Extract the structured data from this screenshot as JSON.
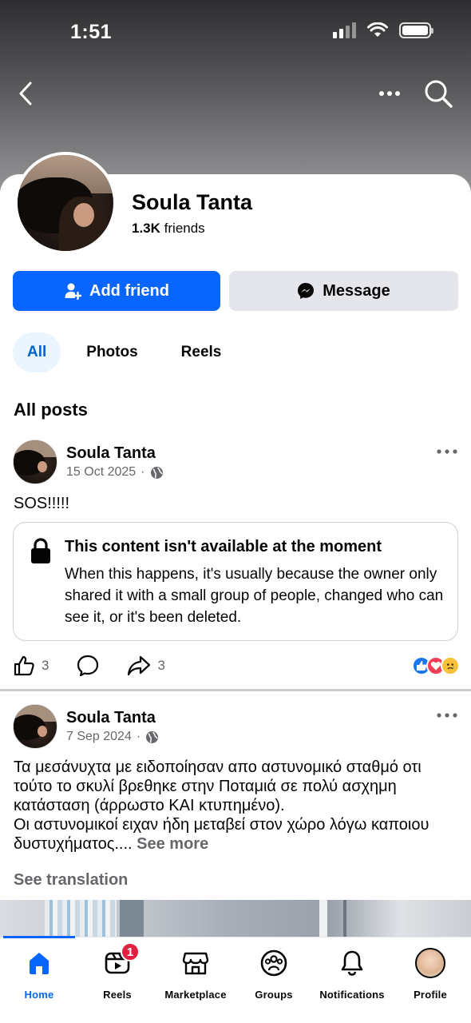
{
  "status_bar": {
    "time": "1:51"
  },
  "profile": {
    "name": "Soula Tanta",
    "friends_count": "1.3K",
    "friends_label": "friends",
    "add_friend_label": "Add friend",
    "message_label": "Message"
  },
  "filters": [
    {
      "label": "All",
      "active": true
    },
    {
      "label": "Photos",
      "active": false
    },
    {
      "label": "Reels",
      "active": false
    }
  ],
  "posts_section_title": "All posts",
  "posts": [
    {
      "author": "Soula Tanta",
      "date": "15 Oct 2025",
      "separator": "·",
      "text": "SOS!!!!!",
      "unavailable": {
        "title": "This content isn't available at the moment",
        "body": "When this happens, it's usually because the owner only shared it with a small group of people, changed who can see it, or it's been deleted."
      },
      "like_count": "3",
      "share_count": "3"
    },
    {
      "author": "Soula Tanta",
      "date": "7 Sep 2024",
      "separator": "·",
      "text": "Τα μεσάνυχτα με ειδοποίησαν απο αστυνομικό σταθμό οτι τούτο το σκυλί βρεθηκε στην Ποταμιά  σε πολύ ασχημη κατάσταση (άρρωστο  ΚΑΙ κτυπημένο).\n Οι αστυνομικοί ειχαν ήδη μεταβεί στον χώρο λόγω καποιου δυστυχήματος....",
      "see_more": "See more",
      "see_translation": "See translation"
    }
  ],
  "tabbar": [
    {
      "label": "Home",
      "icon": "home-icon",
      "active": true
    },
    {
      "label": "Reels",
      "icon": "reels-icon",
      "badge": "1"
    },
    {
      "label": "Marketplace",
      "icon": "marketplace-icon"
    },
    {
      "label": "Groups",
      "icon": "groups-icon"
    },
    {
      "label": "Notifications",
      "icon": "bell-icon"
    },
    {
      "label": "Profile",
      "icon": "profile-avatar"
    }
  ],
  "colors": {
    "accent": "#0866ff",
    "badge": "#e41e3f",
    "secondary_text": "#65676b"
  }
}
